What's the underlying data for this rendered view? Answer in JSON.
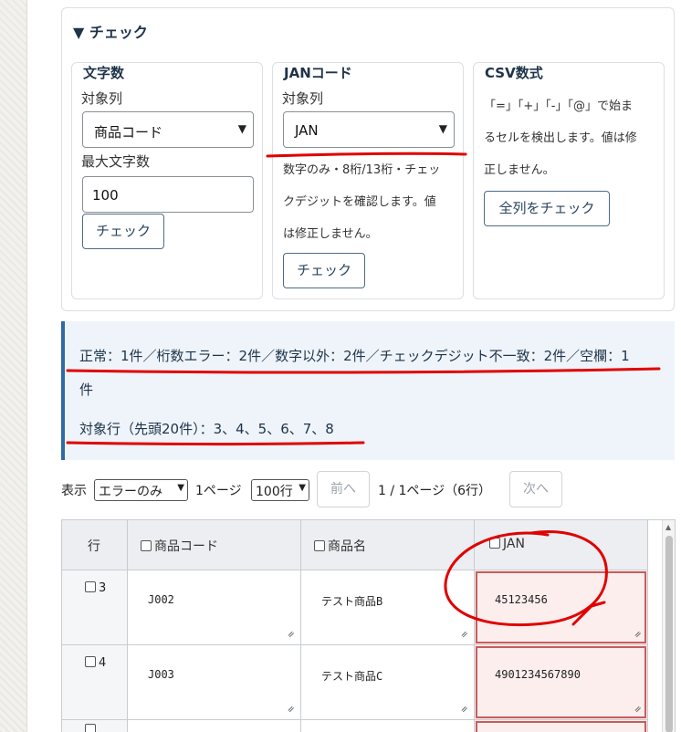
{
  "panel": {
    "summary": "▼ チェック"
  },
  "length_check": {
    "title": "文字数",
    "column_label": "対象列",
    "column_value": "商品コード",
    "max_label": "最大文字数",
    "max_value": "100",
    "button": "チェック"
  },
  "jan_check": {
    "title": "JANコード",
    "column_label": "対象列",
    "column_value": "JAN",
    "desc_lines": [
      "数字のみ・8桁/13桁・チェッ",
      "クデジットを確認します。値",
      "は修正しません。"
    ],
    "button": "チェック"
  },
  "csv_check": {
    "title": "CSV数式",
    "desc_lines": [
      "「=」「+」「-」「@」で始ま",
      "るセルを検出します。値は修",
      "正しません。"
    ],
    "button": "全列をチェック"
  },
  "result": {
    "line1": "正常：1件／桁数エラー：2件／数字以外：2件／チェックデジット不一致：2件／空欄：1",
    "line1b": "件",
    "line2": "対象行（先頭20件）：3、4、5、6、7、8"
  },
  "pager": {
    "show_label": "表示",
    "filter_value": "エラーのみ",
    "page_label": "1ページ",
    "rows_value": "100行",
    "prev": "前へ",
    "status": "1 / 1ページ（6行）",
    "next": "次へ"
  },
  "table": {
    "headers": {
      "row": "行",
      "code": "商品コード",
      "name": "商品名",
      "jan": "JAN"
    },
    "rows": [
      {
        "row": "3",
        "code": "J002",
        "name": "テスト商品B",
        "jan": "45123456"
      },
      {
        "row": "4",
        "code": "J003",
        "name": "テスト商品C",
        "jan": "4901234567890"
      }
    ]
  },
  "colors": {
    "accent": "#2f6aa3",
    "error_bg": "#fdeeee",
    "error_border": "#c95c5c",
    "annotation": "#e00000"
  }
}
